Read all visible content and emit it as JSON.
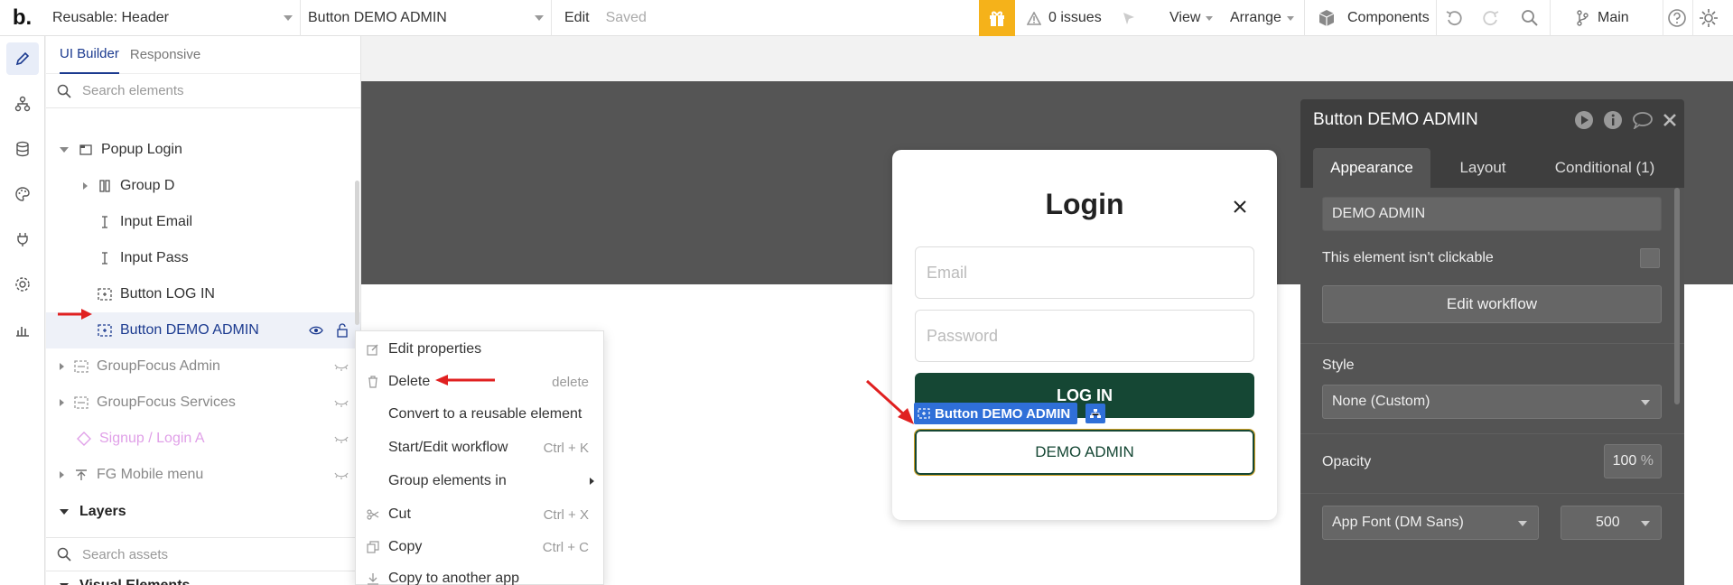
{
  "topbar": {
    "logo": "b",
    "page_dropdown": "Reusable: Header",
    "element_dropdown": "Button DEMO ADMIN",
    "edit_label": "Edit",
    "saved_label": "Saved",
    "issues_label": "0 issues",
    "view_label": "View",
    "arrange_label": "Arrange",
    "components_label": "Components",
    "branch_label": "Main"
  },
  "panel": {
    "tabs": [
      "UI Builder",
      "Responsive"
    ],
    "search_placeholder": "Search elements",
    "tree": [
      {
        "label": "Popup Login"
      },
      {
        "label": "Group D"
      },
      {
        "label": "Input Email"
      },
      {
        "label": "Input Pass"
      },
      {
        "label": "Button LOG IN"
      },
      {
        "label": "Button DEMO ADMIN"
      },
      {
        "label": "GroupFocus Admin"
      },
      {
        "label": "GroupFocus Services"
      },
      {
        "label": "Signup / Login A"
      },
      {
        "label": "FG Mobile menu"
      }
    ],
    "layers_label": "Layers",
    "assets_placeholder": "Search assets",
    "visual_elements_label": "Visual Elements"
  },
  "context_menu": {
    "items": [
      {
        "label": "Edit properties",
        "shortcut": ""
      },
      {
        "label": "Delete",
        "shortcut": "delete"
      },
      {
        "label": "Convert to a reusable element",
        "shortcut": ""
      },
      {
        "label": "Start/Edit workflow",
        "shortcut": "Ctrl + K"
      },
      {
        "label": "Group elements in",
        "shortcut": ""
      },
      {
        "label": "Cut",
        "shortcut": "Ctrl + X"
      },
      {
        "label": "Copy",
        "shortcut": "Ctrl + C"
      },
      {
        "label": "Copy to another app",
        "shortcut": ""
      }
    ]
  },
  "popup": {
    "title": "Login",
    "email_placeholder": "Email",
    "password_placeholder": "Password",
    "login_button": "LOG IN",
    "demo_button": "DEMO ADMIN",
    "selection_label": "Button DEMO ADMIN"
  },
  "property_editor": {
    "title": "Button DEMO ADMIN",
    "tabs": [
      "Appearance",
      "Layout",
      "Conditional (1)"
    ],
    "text_value": "DEMO ADMIN",
    "not_clickable_label": "This element isn't clickable",
    "edit_workflow_label": "Edit workflow",
    "style_label": "Style",
    "style_value": "None (Custom)",
    "opacity_label": "Opacity",
    "opacity_value": "100",
    "opacity_unit": "%",
    "font_value": "App Font (DM Sans)",
    "weight_value": "500"
  },
  "colors": {
    "accent": "#1b3a8f",
    "gift": "#f5b21a",
    "login_button": "#154734",
    "selection": "#2f6fd8",
    "arrow": "#e02020"
  }
}
